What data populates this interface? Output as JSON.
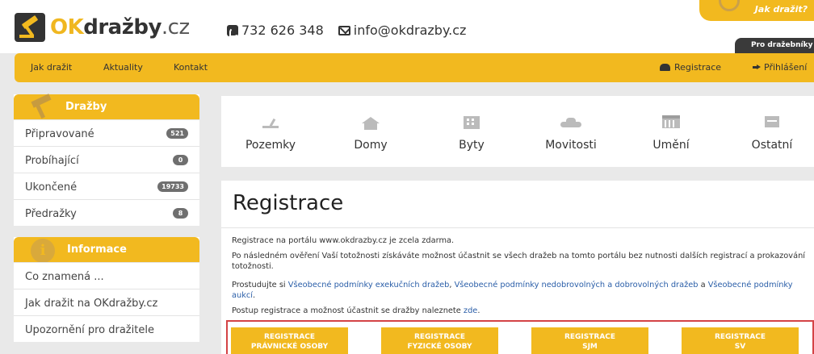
{
  "header": {
    "logo": {
      "ok": "OK",
      "mid": "dražby",
      "tld": ".cz"
    },
    "phone": "732 626 348",
    "email": "info@okdrazby.cz",
    "how_to_bid": "Jak dražit?",
    "for_bidders": "Pro dražebníky"
  },
  "nav": {
    "left": [
      "Jak dražit",
      "Aktuality",
      "Kontakt"
    ],
    "register": "Registrace",
    "login": "Přihlášení"
  },
  "sidebar": {
    "auctions": {
      "title": "Dražby",
      "items": [
        {
          "label": "Připravované",
          "count": "521"
        },
        {
          "label": "Probíhající",
          "count": "0"
        },
        {
          "label": "Ukončené",
          "count": "19733"
        },
        {
          "label": "Předražky",
          "count": "8"
        }
      ]
    },
    "info": {
      "title": "Informace",
      "items": [
        "Co znamená ...",
        "Jak dražit na OKdražby.cz",
        "Upozornění pro dražitele"
      ]
    }
  },
  "categories": [
    {
      "label": "Pozemky",
      "icon": "land-icon"
    },
    {
      "label": "Domy",
      "icon": "house-icon"
    },
    {
      "label": "Byty",
      "icon": "building-icon"
    },
    {
      "label": "Movitosti",
      "icon": "car-icon"
    },
    {
      "label": "Umění",
      "icon": "museum-icon"
    },
    {
      "label": "Ostatní",
      "icon": "box-icon"
    }
  ],
  "content": {
    "title": "Registrace",
    "p1": "Registrace na portálu www.okdrazby.cz je zcela zdarma.",
    "p2": "Po následném ověření Vaší totožnosti získáváte možnost účastnit se všech dražeb na tomto portálu bez nutnosti dalších registrací a prokazování totožnosti.",
    "p3": {
      "before": "Prostudujte si ",
      "link1": "Všeobecné podmínky exekučních dražeb",
      "sep1": ", ",
      "link2": "Všeobecné podmínky nedobrovolných a dobrovolných dražeb",
      "sep2": " a ",
      "link3": "Všeobecné podmínky aukcí",
      "after": "."
    },
    "p4": {
      "before": "Postup registrace a možnost účastnit se dražby naleznete ",
      "link": "zde",
      "after": "."
    },
    "buttons": [
      {
        "line1": "REGISTRACE",
        "line2": "PRÁVNICKÉ OSOBY"
      },
      {
        "line1": "REGISTRACE",
        "line2": "FYZICKÉ OSOBY"
      },
      {
        "line1": "REGISTRACE",
        "line2": "SJM"
      },
      {
        "line1": "REGISTRACE",
        "line2": "SV"
      }
    ]
  },
  "colors": {
    "accent": "#f2b91f",
    "highlight_border": "#d44345",
    "link": "#2a5ea8"
  }
}
